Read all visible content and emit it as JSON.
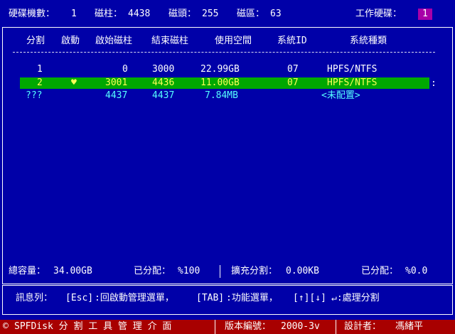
{
  "topbar": {
    "disk_count_label": "硬碟機數：",
    "disk_count": "1",
    "cylinders_label": "磁柱：",
    "cylinders": "4438",
    "heads_label": "磁頭：",
    "heads": "255",
    "sectors_label": "磁區：",
    "sectors": "63",
    "working_disk_label": "工作硬碟：",
    "working_disk": "1"
  },
  "table": {
    "headers": [
      "分割",
      "啟動",
      "啟始磁柱",
      "結束磁柱",
      "使用空間",
      "系統ID",
      "系統種類"
    ],
    "rows": [
      {
        "part": "1",
        "boot": "",
        "start": "0",
        "end": "3000",
        "size": "22.99GB",
        "id": "07",
        "type": "HPFS/NTFS"
      },
      {
        "part": "2",
        "boot": "♥",
        "start": "3001",
        "end": "4436",
        "size": "11.00GB",
        "id": "07",
        "type": "HPFS/NTFS"
      },
      {
        "part": "???",
        "boot": "",
        "start": "4437",
        "end": "4437",
        "size": "7.84MB",
        "id": "",
        "type": "<未配置>"
      }
    ],
    "selected_marker": ":"
  },
  "status": {
    "total_label": "總容量：",
    "total": "34.00GB",
    "allocated_label": "已分配：",
    "allocated": "%100",
    "extended_label": "擴充分割：",
    "extended": "0.00KB",
    "ext_allocated_label": "已分配：",
    "ext_allocated": "%0.0"
  },
  "message": {
    "label": "訊息列：",
    "esc_key": "[Esc]",
    "esc_text": ":回啟動管理選單，",
    "tab_key": "[TAB]",
    "tab_text": ":功能選單，",
    "arrows": "[↑][↓]",
    "enter_text": "↵:處理分割"
  },
  "bottombar": {
    "logo": "©",
    "product": "SPFDisk 分 割 工 具 管 理 介 面",
    "version_label": "版本編號：",
    "version": "2000-3v",
    "designer_label": "設計者：",
    "designer": "馮緒平"
  },
  "colors": {
    "background": "#0000a8",
    "selected_row": "#00a800",
    "selected_text": "#ffff55",
    "free_text": "#55ffff",
    "badge": "#a800a8",
    "bottom_bar": "#a80000"
  }
}
